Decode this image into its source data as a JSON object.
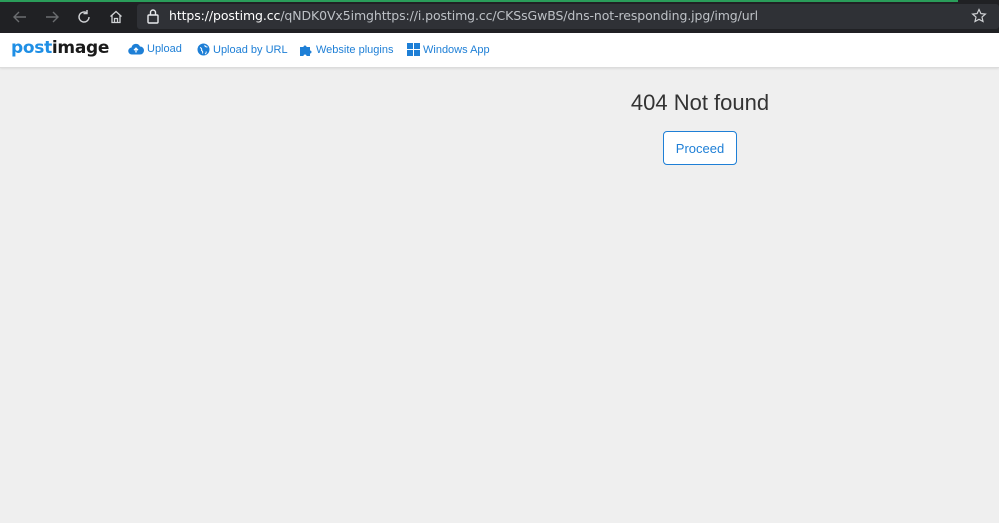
{
  "browser": {
    "url_host": "https://postimg.cc",
    "url_path": "/qNDK0Vx5imghttps://i.postimg.cc/CKSsGwBS/dns-not-responding.jpg/img/url",
    "icons": [
      "back-arrow-icon",
      "forward-arrow-icon",
      "reload-icon",
      "home-icon",
      "lock-icon",
      "star-icon"
    ]
  },
  "site": {
    "logo_part1": "post",
    "logo_part2": "image",
    "nav": [
      {
        "label": "Upload",
        "icon": "cloud-upload-icon"
      },
      {
        "label": "Upload by URL",
        "icon": "globe-icon"
      },
      {
        "label": "Website plugins",
        "icon": "puzzle-icon"
      },
      {
        "label": "Windows App",
        "icon": "windows-icon"
      }
    ]
  },
  "main": {
    "title": "404 Not found",
    "proceed_label": "Proceed"
  },
  "colors": {
    "accent": "#1e7fd6",
    "logo_blue": "#1f8fe5",
    "chrome_bg": "#202124",
    "page_bg": "#efefef",
    "load_line": "#2a9d5a"
  }
}
